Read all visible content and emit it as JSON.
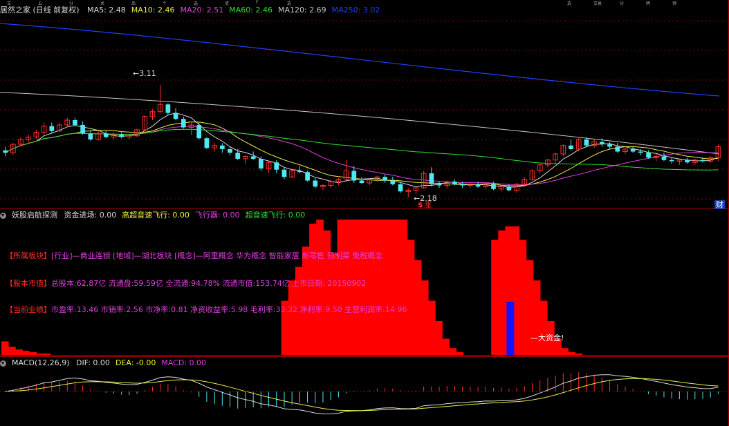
{
  "header": {
    "title": "居然之家 (日线 前复权)",
    "ma": [
      {
        "label": "MA5: 2.48",
        "color": "#dcdcdc"
      },
      {
        "label": "MA10: 2.46",
        "color": "#f0f040"
      },
      {
        "label": "MA20: 2.51",
        "color": "#e040e0"
      },
      {
        "label": "MA60: 2.46",
        "color": "#30e030"
      },
      {
        "label": "MA120: 2.69",
        "color": "#c8c8c8"
      },
      {
        "label": "MA250: 3.02",
        "color": "#2040ff"
      }
    ]
  },
  "top_menu": [
    "交",
    "五",
    "分",
    "关",
    "品",
    "个",
    "选",
    "资",
    "F",
    "选"
  ],
  "top_right": [
    "选",
    "交易",
    "分",
    "明",
    "预"
  ],
  "price_panel": {
    "high_label": "3.11",
    "low_label": "2.18",
    "badge_s": "$",
    "badge_zhang": "涨",
    "badge_cai": "财"
  },
  "indicator_panel": {
    "name": "妖股启航探测",
    "items": [
      {
        "label": "资金进场: 0.00",
        "color": "#dcdcdc"
      },
      {
        "label": "高超音速飞行: 0.00",
        "color": "#f0f040"
      },
      {
        "label": "飞行器: 0.00",
        "color": "#e040e0"
      },
      {
        "label": "超音速飞行: 0.00",
        "color": "#30e030"
      }
    ],
    "info_lines": [
      {
        "tag": "【所属板块】",
        "text": "[行业]—商业连锁 [地域]—湖北板块 [概念]—阿里概念 华为概念 智能家居 新零售 预制菜 免税概念"
      },
      {
        "tag": "【股本市值】",
        "text": "总股本:62.87亿 流通盘:59.59亿 全流通:94.78% 流通市值:153.74亿 上市日期: 20150902"
      },
      {
        "tag": "【当前业绩】",
        "text": "市盈率:13.46 市销率:2.56 市净率:0.81 净资收益率:5.98 毛利率:33.32 净利率:9.50 主营利润率:14.96"
      }
    ],
    "big_money_label": "大资金!"
  },
  "macd_panel": {
    "name": "MACD(12,26,9)",
    "items": [
      {
        "label": "DIF: 0.00",
        "color": "#dcdcdc"
      },
      {
        "label": "DEA: -0.00",
        "color": "#f0f040"
      },
      {
        "label": "MACD: 0.00",
        "color": "#e040e0"
      }
    ]
  },
  "colors": {
    "up": "#ff3030",
    "down": "#50e8f0",
    "grid": "#8b0000",
    "frame": "#b00000"
  },
  "chart_data": {
    "type": "candlestick",
    "price_range": [
      2.1,
      3.7
    ],
    "candles": [
      [
        2.57,
        2.6,
        2.52,
        2.55
      ],
      [
        2.55,
        2.63,
        2.53,
        2.62
      ],
      [
        2.62,
        2.68,
        2.6,
        2.66
      ],
      [
        2.66,
        2.7,
        2.63,
        2.68
      ],
      [
        2.68,
        2.74,
        2.66,
        2.72
      ],
      [
        2.72,
        2.8,
        2.7,
        2.77
      ],
      [
        2.77,
        2.8,
        2.71,
        2.73
      ],
      [
        2.73,
        2.8,
        2.72,
        2.78
      ],
      [
        2.78,
        2.84,
        2.76,
        2.82
      ],
      [
        2.82,
        2.84,
        2.77,
        2.78
      ],
      [
        2.78,
        2.81,
        2.7,
        2.71
      ],
      [
        2.71,
        2.73,
        2.65,
        2.66
      ],
      [
        2.66,
        2.73,
        2.65,
        2.71
      ],
      [
        2.71,
        2.73,
        2.67,
        2.68
      ],
      [
        2.68,
        2.72,
        2.66,
        2.7
      ],
      [
        2.7,
        2.72,
        2.67,
        2.68
      ],
      [
        2.68,
        2.7,
        2.66,
        2.69
      ],
      [
        2.69,
        2.75,
        2.68,
        2.74
      ],
      [
        2.74,
        2.86,
        2.73,
        2.85
      ],
      [
        2.85,
        2.91,
        2.82,
        2.89
      ],
      [
        2.89,
        3.11,
        2.88,
        2.95
      ],
      [
        2.95,
        2.96,
        2.86,
        2.88
      ],
      [
        2.88,
        2.92,
        2.82,
        2.83
      ],
      [
        2.83,
        2.85,
        2.75,
        2.76
      ],
      [
        2.76,
        2.8,
        2.7,
        2.78
      ],
      [
        2.78,
        2.8,
        2.66,
        2.67
      ],
      [
        2.67,
        2.68,
        2.58,
        2.59
      ],
      [
        2.59,
        2.63,
        2.56,
        2.61
      ],
      [
        2.61,
        2.63,
        2.55,
        2.58
      ],
      [
        2.58,
        2.6,
        2.53,
        2.55
      ],
      [
        2.55,
        2.58,
        2.49,
        2.5
      ],
      [
        2.5,
        2.53,
        2.46,
        2.52
      ],
      [
        2.52,
        2.56,
        2.49,
        2.5
      ],
      [
        2.5,
        2.52,
        2.4,
        2.42
      ],
      [
        2.42,
        2.48,
        2.38,
        2.47
      ],
      [
        2.47,
        2.49,
        2.38,
        2.41
      ],
      [
        2.41,
        2.43,
        2.33,
        2.35
      ],
      [
        2.35,
        2.42,
        2.34,
        2.4
      ],
      [
        2.4,
        2.44,
        2.38,
        2.39
      ],
      [
        2.39,
        2.4,
        2.31,
        2.32
      ],
      [
        2.32,
        2.34,
        2.26,
        2.27
      ],
      [
        2.27,
        2.29,
        2.24,
        2.28
      ],
      [
        2.28,
        2.33,
        2.26,
        2.31
      ],
      [
        2.31,
        2.34,
        2.28,
        2.33
      ],
      [
        2.33,
        2.49,
        2.32,
        2.4
      ],
      [
        2.4,
        2.44,
        2.3,
        2.32
      ],
      [
        2.32,
        2.35,
        2.29,
        2.3
      ],
      [
        2.3,
        2.34,
        2.28,
        2.33
      ],
      [
        2.33,
        2.36,
        2.31,
        2.35
      ],
      [
        2.35,
        2.37,
        2.3,
        2.32
      ],
      [
        2.32,
        2.35,
        2.28,
        2.29
      ],
      [
        2.29,
        2.31,
        2.22,
        2.23
      ],
      [
        2.23,
        2.26,
        2.18,
        2.24
      ],
      [
        2.24,
        2.27,
        2.21,
        2.26
      ],
      [
        2.26,
        2.4,
        2.25,
        2.38
      ],
      [
        2.38,
        2.43,
        2.27,
        2.29
      ],
      [
        2.29,
        2.31,
        2.26,
        2.28
      ],
      [
        2.28,
        2.32,
        2.26,
        2.31
      ],
      [
        2.31,
        2.33,
        2.28,
        2.29
      ],
      [
        2.29,
        2.31,
        2.26,
        2.28
      ],
      [
        2.28,
        2.3,
        2.26,
        2.29
      ],
      [
        2.29,
        2.31,
        2.26,
        2.27
      ],
      [
        2.27,
        2.3,
        2.25,
        2.29
      ],
      [
        2.29,
        2.31,
        2.24,
        2.25
      ],
      [
        2.25,
        2.28,
        2.23,
        2.27
      ],
      [
        2.27,
        2.29,
        2.23,
        2.24
      ],
      [
        2.24,
        2.3,
        2.22,
        2.29
      ],
      [
        2.29,
        2.35,
        2.27,
        2.33
      ],
      [
        2.33,
        2.41,
        2.32,
        2.4
      ],
      [
        2.4,
        2.46,
        2.38,
        2.45
      ],
      [
        2.45,
        2.5,
        2.43,
        2.49
      ],
      [
        2.49,
        2.55,
        2.46,
        2.54
      ],
      [
        2.54,
        2.62,
        2.52,
        2.61
      ],
      [
        2.61,
        2.66,
        2.57,
        2.58
      ],
      [
        2.58,
        2.68,
        2.56,
        2.66
      ],
      [
        2.66,
        2.68,
        2.6,
        2.61
      ],
      [
        2.61,
        2.66,
        2.59,
        2.64
      ],
      [
        2.64,
        2.67,
        2.6,
        2.62
      ],
      [
        2.62,
        2.64,
        2.58,
        2.6
      ],
      [
        2.6,
        2.63,
        2.55,
        2.56
      ],
      [
        2.56,
        2.59,
        2.54,
        2.58
      ],
      [
        2.58,
        2.6,
        2.55,
        2.56
      ],
      [
        2.56,
        2.58,
        2.53,
        2.55
      ],
      [
        2.55,
        2.57,
        2.5,
        2.51
      ],
      [
        2.51,
        2.54,
        2.48,
        2.52
      ],
      [
        2.52,
        2.55,
        2.48,
        2.49
      ],
      [
        2.49,
        2.51,
        2.46,
        2.48
      ],
      [
        2.48,
        2.5,
        2.45,
        2.49
      ],
      [
        2.49,
        2.51,
        2.46,
        2.47
      ],
      [
        2.47,
        2.5,
        2.45,
        2.49
      ],
      [
        2.49,
        2.51,
        2.47,
        2.48
      ],
      [
        2.48,
        2.52,
        2.47,
        2.51
      ],
      [
        2.51,
        2.62,
        2.48,
        2.6
      ]
    ],
    "moving_averages": [
      {
        "name": "MA5",
        "color": "#dcdcdc",
        "period": 5
      },
      {
        "name": "MA10",
        "color": "#f0f040",
        "period": 10
      },
      {
        "name": "MA20",
        "color": "#e040e0",
        "period": 20
      },
      {
        "name": "MA60",
        "color": "#30e030",
        "period": 60
      }
    ],
    "ma120_line": [
      3.05,
      2.66
    ],
    "ma250_line": [
      3.62,
      3.02
    ],
    "indicator_bars": [
      0.1,
      0.06,
      0.04,
      0.03,
      0.02,
      0.01,
      0.01,
      0,
      0,
      0,
      0,
      0,
      0,
      0,
      0,
      0,
      0,
      0,
      0,
      0,
      0,
      0,
      0,
      0,
      0,
      0,
      0,
      0,
      0,
      0,
      0,
      0,
      0,
      0,
      0,
      0,
      0,
      0,
      0,
      0,
      0.4,
      0.55,
      0.65,
      0.8,
      0.97,
      1.0,
      0.92,
      0.75,
      1.0,
      1.0,
      1.0,
      1.0,
      1.0,
      1.0,
      1.0,
      1.0,
      1.0,
      1.0,
      0.85,
      0.7,
      0.55,
      0.4,
      0.25,
      0.12,
      0.05,
      0.02,
      0,
      0,
      0,
      0,
      0.85,
      0.92,
      0.95,
      0.95,
      0.85,
      0.7,
      0.55,
      0.4,
      0.25,
      0.12,
      0.05,
      0.02,
      0.01,
      0,
      0,
      0,
      0,
      0,
      0,
      0,
      0,
      0,
      0,
      0,
      0,
      0,
      0,
      0,
      0,
      0,
      0,
      0,
      0
    ],
    "big_money_bar_index": 72,
    "indicator_range": [
      0,
      1.0
    ],
    "macd_range": [
      -0.13,
      0.09
    ]
  }
}
